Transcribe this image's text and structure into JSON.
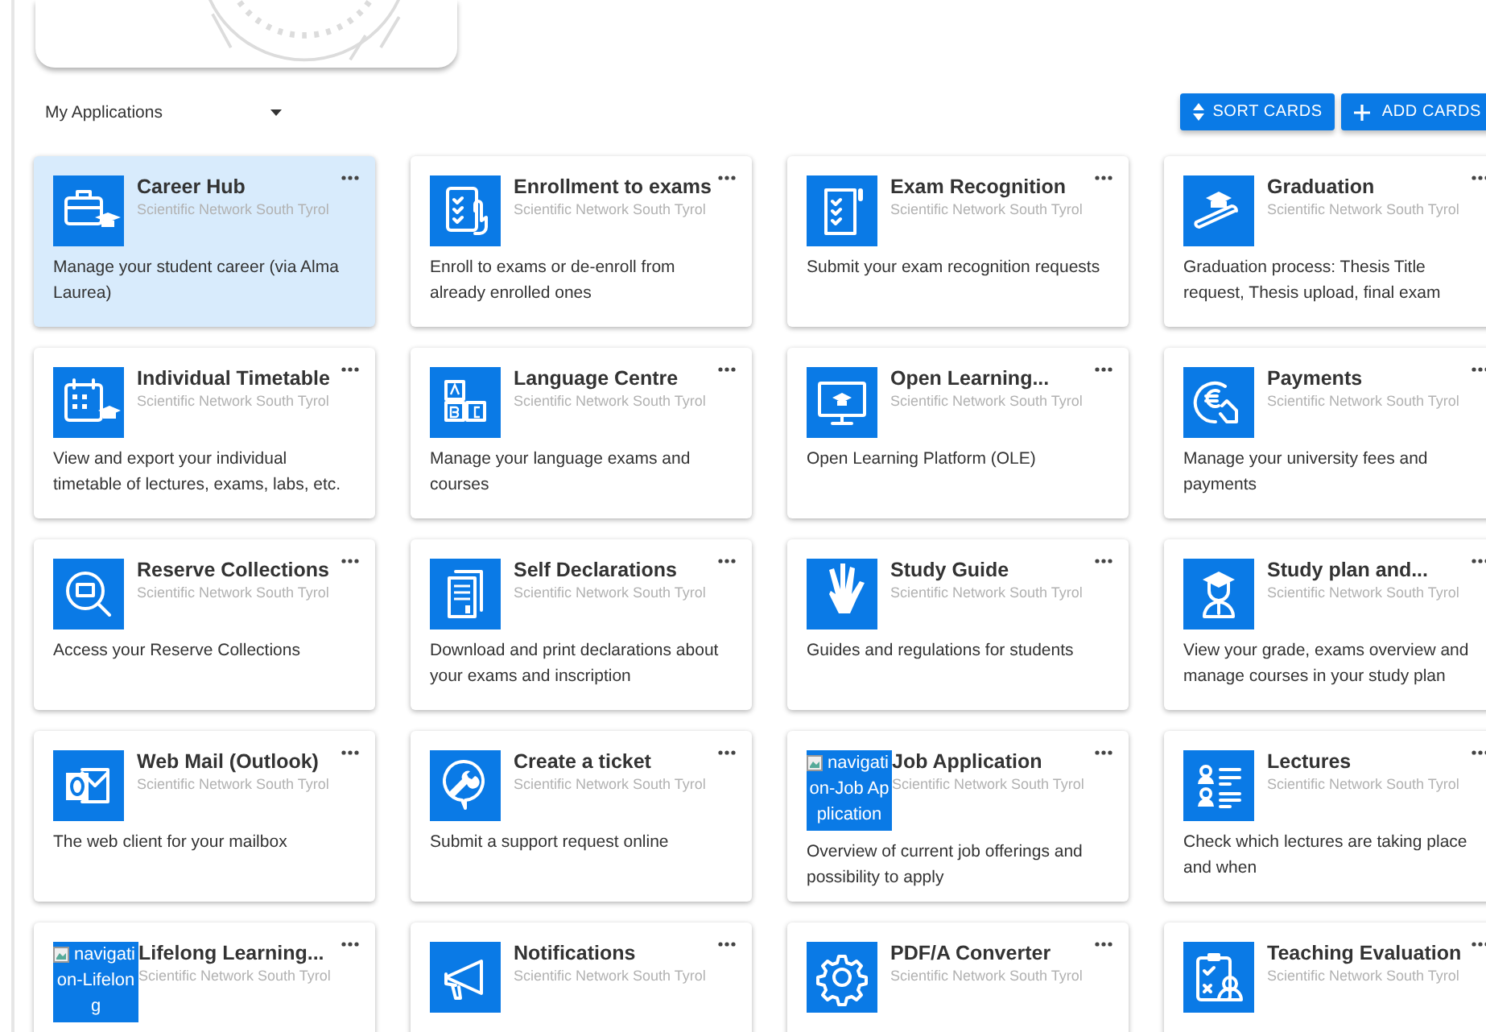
{
  "filter": {
    "label": "My Applications"
  },
  "toolbar": {
    "buttons": [
      {
        "kind": "sort",
        "label": "SORT CARDS"
      },
      {
        "kind": "add",
        "label": "ADD CARDS"
      }
    ]
  },
  "cards": [
    {
      "title": "Career Hub",
      "subtitle": "Scientific Network South Tyrol",
      "description": "Manage your student career (via Alma Laurea)",
      "kind": "briefcase",
      "selected": true
    },
    {
      "title": "Enrollment to exams",
      "subtitle": "Scientific Network South Tyrol",
      "description": "Enroll to exams or de-enroll from already enrolled ones",
      "kind": "checklist",
      "selected": false
    },
    {
      "title": "Exam Recognition",
      "subtitle": "Scientific Network South Tyrol",
      "description": "Submit your exam recognition requests",
      "kind": "document",
      "selected": false
    },
    {
      "title": "Graduation",
      "subtitle": "Scientific Network South Tyrol",
      "description": "Graduation process: Thesis Title request, Thesis upload, final exam",
      "kind": "graduation",
      "selected": false
    },
    {
      "title": "Individual Timetable",
      "subtitle": "Scientific Network South Tyrol",
      "description": "View and export your individual timetable of lectures, exams, labs, etc.",
      "kind": "calendar",
      "selected": false
    },
    {
      "title": "Language Centre",
      "subtitle": "Scientific Network South Tyrol",
      "description": "Manage your language exams and courses",
      "kind": "blocks",
      "selected": false
    },
    {
      "title": "Open Learning...",
      "subtitle": "Scientific Network South Tyrol",
      "description": "Open Learning Platform (OLE)",
      "kind": "monitor",
      "selected": false
    },
    {
      "title": "Payments",
      "subtitle": "Scientific Network South Tyrol",
      "description": "Manage your university fees and payments",
      "kind": "euro",
      "selected": false
    },
    {
      "title": "Reserve Collections",
      "subtitle": "Scientific Network South Tyrol",
      "description": "Access your Reserve Collections",
      "kind": "search",
      "selected": false
    },
    {
      "title": "Self Declarations",
      "subtitle": "Scientific Network South Tyrol",
      "description": "Download and print declarations about your exams and inscription",
      "kind": "documents",
      "selected": false
    },
    {
      "title": "Study Guide",
      "subtitle": "Scientific Network South Tyrol",
      "description": "Guides and regulations for students",
      "kind": "hand",
      "selected": false
    },
    {
      "title": "Study plan and...",
      "subtitle": "Scientific Network South Tyrol",
      "description": "View your grade, exams overview and manage courses in your study plan",
      "kind": "student",
      "selected": false
    },
    {
      "title": "Web Mail (Outlook)",
      "subtitle": "Scientific Network South Tyrol",
      "description": "The web client for your mailbox",
      "kind": "mail",
      "selected": false
    },
    {
      "title": "Create a ticket",
      "subtitle": "Scientific Network South Tyrol",
      "description": "Submit a support request online",
      "kind": "wrench",
      "selected": false
    },
    {
      "title": "Job Application",
      "subtitle": "Scientific Network South Tyrol",
      "description": "Overview of current job offerings and possibility to apply",
      "kind": "broken",
      "alt": "navigation-Job Application",
      "selected": false
    },
    {
      "title": "Lectures",
      "subtitle": "Scientific Network South Tyrol",
      "description": "Check which lectures are taking place and when",
      "kind": "people-list",
      "selected": false
    },
    {
      "title": "Lifelong Learning...",
      "subtitle": "Scientific Network South Tyrol",
      "kind": "broken",
      "alt": "navigation-Lifelong",
      "selected": false
    },
    {
      "title": "Notifications",
      "subtitle": "Scientific Network South Tyrol",
      "kind": "megaphone",
      "selected": false
    },
    {
      "title": "PDF/A Converter",
      "subtitle": "Scientific Network South Tyrol",
      "kind": "gear",
      "selected": false
    },
    {
      "title": "Teaching Evaluation",
      "subtitle": "Scientific Network South Tyrol",
      "kind": "clipboard",
      "selected": false
    }
  ]
}
